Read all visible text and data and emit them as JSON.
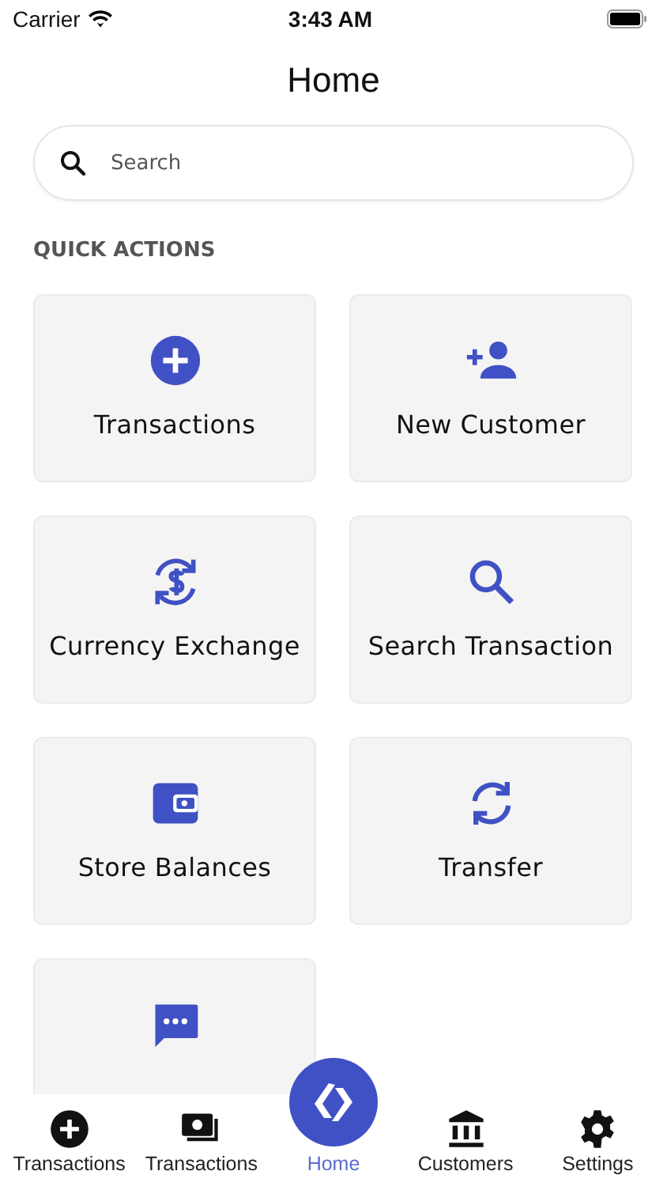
{
  "status_bar": {
    "carrier": "Carrier",
    "time": "3:43 AM"
  },
  "title": "Home",
  "search": {
    "placeholder": "Search"
  },
  "section_title": "QUICK ACTIONS",
  "actions": [
    {
      "kind": "action",
      "label": "Transactions"
    },
    {
      "kind": "action",
      "label": "New Customer"
    },
    {
      "kind": "action",
      "label": "Currency Exchange"
    },
    {
      "kind": "action",
      "label": "Search Transaction"
    },
    {
      "kind": "action",
      "label": "Store Balances"
    },
    {
      "kind": "action",
      "label": "Transfer"
    },
    {
      "kind": "action"
    }
  ],
  "tabs": [
    {
      "label": "Transactions",
      "selected": false
    },
    {
      "label": "Transactions",
      "selected": false
    },
    {
      "label": "Home",
      "selected": true
    },
    {
      "label": "Customers",
      "selected": false
    },
    {
      "label": "Settings",
      "selected": false
    }
  ]
}
